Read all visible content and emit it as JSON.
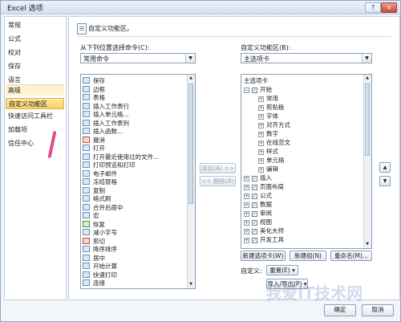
{
  "window": {
    "title": "Excel 选项",
    "help": "?",
    "close": "×"
  },
  "sidebar": {
    "items": [
      {
        "label": "常规"
      },
      {
        "label": "公式"
      },
      {
        "label": "校对"
      },
      {
        "label": "保存"
      },
      {
        "label": "语言"
      },
      {
        "label": "高级"
      },
      {
        "label": "自定义功能区"
      },
      {
        "label": "快速访问工具栏"
      },
      {
        "label": "加载项"
      },
      {
        "label": "信任中心"
      }
    ],
    "active_index": 6
  },
  "main": {
    "header": "自定义功能区。",
    "left_label": "从下列位置选择命令(C):",
    "left_combo": "常用命令",
    "right_label": "自定义功能区(B):",
    "right_combo": "主选项卡",
    "commands": [
      {
        "label": "保存",
        "icon": "save-icon"
      },
      {
        "label": "边框",
        "icon": "border-icon"
      },
      {
        "label": "表格",
        "icon": "table-icon"
      },
      {
        "label": "插入工作表行",
        "icon": "insert-row-icon"
      },
      {
        "label": "插入单元格...",
        "icon": "insert-cell-icon"
      },
      {
        "label": "插入工作表列",
        "icon": "insert-column-icon"
      },
      {
        "label": "插入函数...",
        "icon": "function-icon"
      },
      {
        "label": "撤消",
        "icon": "undo-icon"
      },
      {
        "label": "打开",
        "icon": "open-icon"
      },
      {
        "label": "打开最近使用过的文件...",
        "icon": "recent-icon"
      },
      {
        "label": "打印预览和打印",
        "icon": "print-preview-icon"
      },
      {
        "label": "电子邮件",
        "icon": "email-icon"
      },
      {
        "label": "冻结窗格",
        "icon": "freeze-icon"
      },
      {
        "label": "复制",
        "icon": "copy-icon"
      },
      {
        "label": "格式刷",
        "icon": "format-painter-icon"
      },
      {
        "label": "合并后居中",
        "icon": "merge-icon"
      },
      {
        "label": "宏",
        "icon": "macro-icon"
      },
      {
        "label": "恢复",
        "icon": "redo-icon"
      },
      {
        "label": "减小字号",
        "icon": "font-decrease-icon"
      },
      {
        "label": "剪切",
        "icon": "cut-icon"
      },
      {
        "label": "降序排序",
        "icon": "sort-desc-icon"
      },
      {
        "label": "居中",
        "icon": "center-icon"
      },
      {
        "label": "开始计算",
        "icon": "calculate-icon"
      },
      {
        "label": "快速打印",
        "icon": "quick-print-icon"
      },
      {
        "label": "连接",
        "icon": "connection-icon"
      }
    ],
    "tree": [
      {
        "label": "主选项卡",
        "level": 0,
        "expander": "",
        "checkbox": false
      },
      {
        "label": "开始",
        "level": 0,
        "expander": "⊟",
        "checkbox": true
      },
      {
        "label": "常用",
        "level": 1,
        "expander": "⊞",
        "checkbox": false
      },
      {
        "label": "剪贴板",
        "level": 1,
        "expander": "⊞",
        "checkbox": false
      },
      {
        "label": "字体",
        "level": 1,
        "expander": "⊞",
        "checkbox": false
      },
      {
        "label": "对齐方式",
        "level": 1,
        "expander": "⊞",
        "checkbox": false
      },
      {
        "label": "数字",
        "level": 1,
        "expander": "⊞",
        "checkbox": false
      },
      {
        "label": "在线范文",
        "level": 1,
        "expander": "⊞",
        "checkbox": false
      },
      {
        "label": "样式",
        "level": 1,
        "expander": "⊞",
        "checkbox": false
      },
      {
        "label": "单元格",
        "level": 1,
        "expander": "⊞",
        "checkbox": false
      },
      {
        "label": "编辑",
        "level": 1,
        "expander": "⊞",
        "checkbox": false
      },
      {
        "label": "插入",
        "level": 0,
        "expander": "⊞",
        "checkbox": true
      },
      {
        "label": "页面布局",
        "level": 0,
        "expander": "⊞",
        "checkbox": true
      },
      {
        "label": "公式",
        "level": 0,
        "expander": "⊞",
        "checkbox": true
      },
      {
        "label": "数据",
        "level": 0,
        "expander": "⊞",
        "checkbox": true
      },
      {
        "label": "审阅",
        "level": 0,
        "expander": "⊞",
        "checkbox": true
      },
      {
        "label": "视图",
        "level": 0,
        "expander": "⊞",
        "checkbox": true
      },
      {
        "label": "美化大师",
        "level": 0,
        "expander": "⊞",
        "checkbox": true
      },
      {
        "label": "开发工具",
        "level": 0,
        "expander": "⊞",
        "checkbox": true
      }
    ],
    "add_button": "添加(A) >>",
    "remove_button": "<< 删除(R)",
    "new_tab_button": "新建选项卡(W)",
    "new_group_button": "新建组(N)",
    "rename_button": "重命名(M)...",
    "customize_label": "自定义:",
    "reset_button": "重置(E) ▾",
    "import_export_button": "导入/导出(P) ▾",
    "move_up": "▲",
    "move_down": "▼"
  },
  "footer": {
    "ok": "确定",
    "cancel": "取消"
  },
  "watermark": "我爱IT技术网"
}
